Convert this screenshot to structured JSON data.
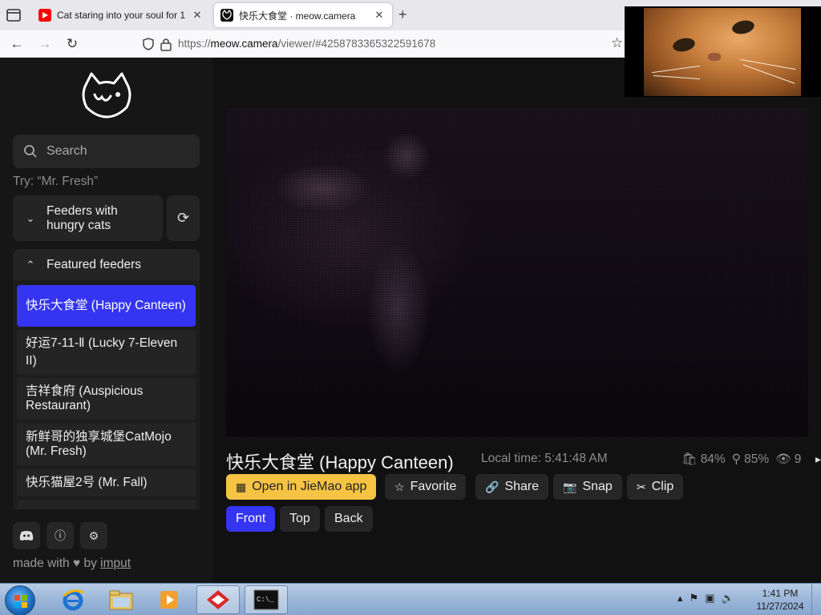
{
  "browser": {
    "tabs": [
      {
        "title": "Cat staring into your soul for 1",
        "active": false
      },
      {
        "title": "快乐大食堂 · meow.camera",
        "active": true
      }
    ],
    "url_prefix": "https://",
    "url_host": "meow.camera",
    "url_path": "/viewer/#4258783365322591678"
  },
  "sidebar": {
    "search_placeholder": "Search",
    "hint": "Try: “Mr. Fresh”",
    "groups": {
      "hungry": "Feeders with hungry cats",
      "featured": "Featured feeders"
    },
    "feeders": [
      {
        "label": "快乐大食堂 (Happy Canteen)",
        "active": true
      },
      {
        "label": "好运7-11-Ⅱ (Lucky 7-Eleven II)",
        "active": false
      },
      {
        "label": "吉祥食府 (Auspicious Restaurant)",
        "active": false
      },
      {
        "label": "新鲜哥的独享城堡CatMojo (Mr. Fresh)",
        "active": false
      },
      {
        "label": "快乐猫屋2号 (Mr. Fall)",
        "active": false
      }
    ],
    "footer": {
      "made_with": "made with",
      "by": "by",
      "author": "imput"
    }
  },
  "viewer": {
    "title": "快乐大食堂 (Happy Canteen)",
    "local_time": "Local time: 5:41:48 AM",
    "stats": {
      "food": "84%",
      "signal": "85%",
      "viewers": "9"
    },
    "actions": {
      "open_app": "Open in JieMao app",
      "favorite": "Favorite",
      "share": "Share",
      "snap": "Snap",
      "clip": "Clip"
    },
    "cameras": [
      "Front",
      "Top",
      "Back"
    ],
    "active_camera": "Front"
  },
  "taskbar": {
    "time": "1:41 PM",
    "date": "11/27/2024"
  },
  "colors": {
    "accent": "#3434f2",
    "yellow": "#f6c343"
  }
}
